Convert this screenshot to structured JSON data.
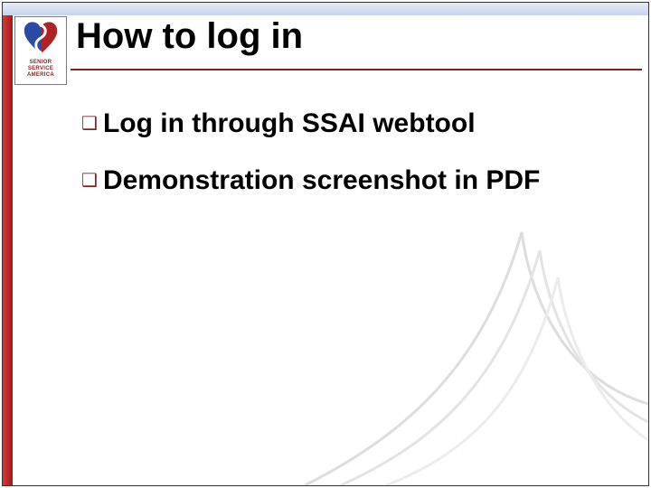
{
  "logo": {
    "line1": "SENIOR",
    "line2": "SERVICE",
    "line3": "AMERICA"
  },
  "title": "How to log in",
  "bullets": [
    {
      "text": "Log in through SSAI webtool"
    },
    {
      "text": "Demonstration screenshot in PDF"
    }
  ],
  "colors": {
    "accent_red": "#8a1f1f",
    "bar_blue_top": "#e6ecf7",
    "bar_blue_bottom": "#c7d4ef"
  }
}
